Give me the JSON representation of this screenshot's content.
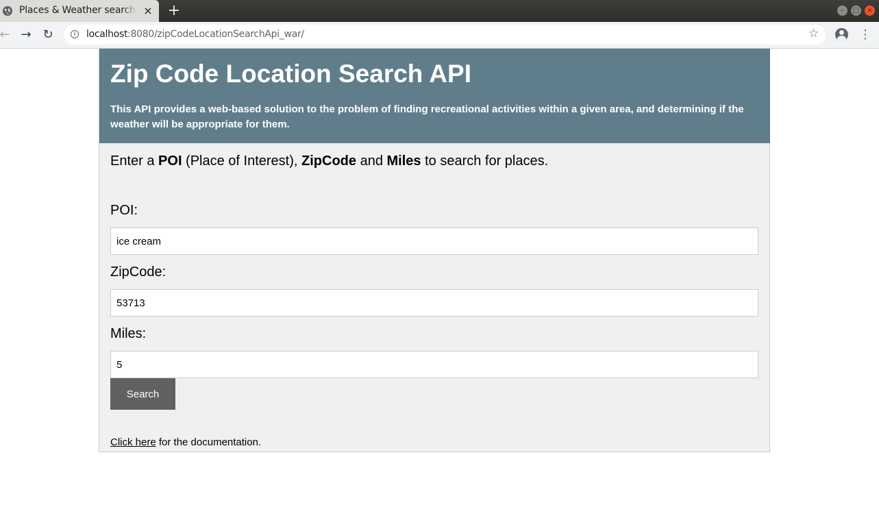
{
  "browser": {
    "tab_title": "Places & Weather search by zip code",
    "tab_close": "×",
    "new_tab": "+",
    "url_host": "localhost",
    "url_path": ":8080/zipCodeLocationSearchApi_war/",
    "icons": [
      "globe-icon",
      "close-icon",
      "plus-icon",
      "back-icon",
      "forward-icon",
      "reload-icon",
      "info-icon",
      "star-icon",
      "account-icon",
      "menu-icon"
    ]
  },
  "header": {
    "title": "Zip Code Location Search API",
    "description": "This API provides a web-based solution to the problem of finding recreational activities within a given area, and determining if the weather will be appropriate for them."
  },
  "intro": {
    "prefix": "Enter a ",
    "poi": "POI",
    "poi_paren": " (Place of Interest), ",
    "zipcode": "ZipCode",
    "and": " and ",
    "miles": "Miles",
    "suffix": " to search for places."
  },
  "form": {
    "poi_label": "POI:",
    "poi_value": "ice cream",
    "zip_label": "ZipCode:",
    "zip_value": "53713",
    "miles_label": "Miles:",
    "miles_value": "5",
    "search_label": "Search"
  },
  "footer": {
    "link_text": "Click here",
    "rest": " for the documentation."
  },
  "colors": {
    "header_bg": "#607d8b",
    "button_bg": "#616161",
    "panel_bg": "#f0f0f0"
  }
}
